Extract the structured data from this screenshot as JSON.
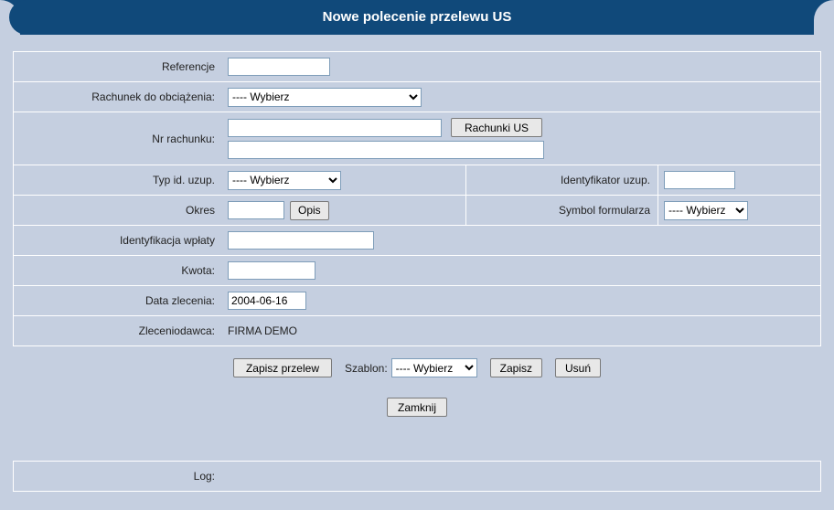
{
  "title": "Nowe polecenie przelewu US",
  "labels": {
    "referencje": "Referencje",
    "rachunek_do_obciazenia": "Rachunek do obciążenia:",
    "nr_rachunku": "Nr rachunku:",
    "typ_id_uzup": "Typ id. uzup.",
    "identyfikator_uzup": "Identyfikator uzup.",
    "okres": "Okres",
    "symbol_formularza": "Symbol formularza",
    "identyfikacja_wplaty": "Identyfikacja wpłaty",
    "kwota": "Kwota:",
    "data_zlecenia": "Data zlecenia:",
    "zleceniodawca": "Zleceniodawca:",
    "szablon": "Szablon:",
    "log": "Log:"
  },
  "buttons": {
    "rachunki_us": "Rachunki US",
    "opis": "Opis",
    "zapisz_przelew": "Zapisz przelew",
    "zapisz": "Zapisz",
    "usun": "Usuń",
    "zamknij": "Zamknij"
  },
  "values": {
    "referencje": "",
    "rachunek_do_obciazenia_selected": "---- Wybierz",
    "nr_rachunku_1": "",
    "nr_rachunku_2": "",
    "typ_id_uzup_selected": "---- Wybierz",
    "identyfikator_uzup": "",
    "okres": "",
    "symbol_formularza_selected": "---- Wybierz",
    "identyfikacja_wplaty": "",
    "kwota": "",
    "data_zlecenia": "2004-06-16",
    "zleceniodawca": "FIRMA DEMO",
    "szablon_selected": "---- Wybierz",
    "log": ""
  },
  "options": {
    "wybierz": "---- Wybierz"
  }
}
